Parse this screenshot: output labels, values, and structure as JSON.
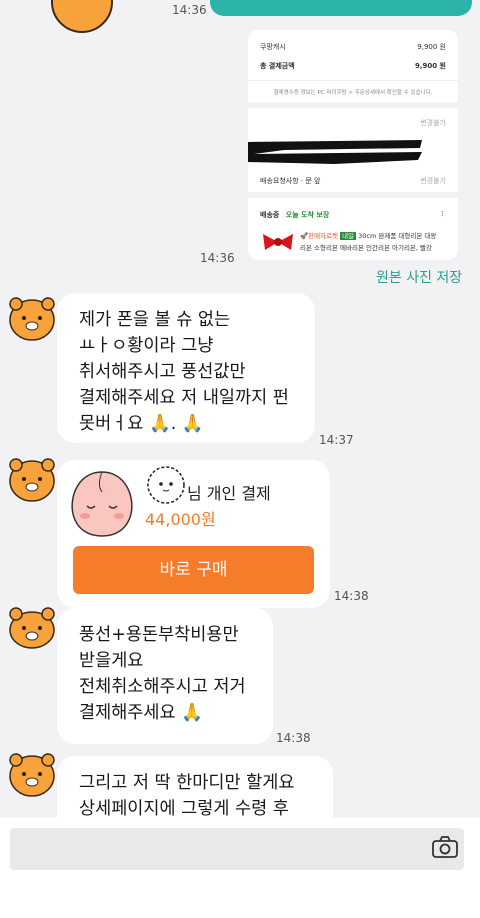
{
  "top": {
    "time": "14:36"
  },
  "receipt": {
    "coupang_cash_label": "쿠팡캐시",
    "coupang_cash_value": "9,900 원",
    "total_label": "총 결제금액",
    "total_value": "9,900 원",
    "notice": "결제영수증 정보는 PC 마이쿠팡 > 주문상세에서 확인할 수 있습니다.",
    "change_label_1": "변경불가",
    "delivery_request_label": "배송요청사항 · 문 앞",
    "change_label_2": "변경불가",
    "shipping_status": "배송중",
    "shipping_promise": "오늘 도착 보장",
    "product_badge_1": "🚀판매자로켓",
    "product_badge_2": "내일",
    "product_line_1": "30cm 완제품 대형리본 대왕",
    "product_line_2": "리본 소형리본 에바리본 인간리본 아기리본, 빨강"
  },
  "photo_time": "14:36",
  "save_original": "원본 사진 저장",
  "messages": [
    {
      "lines": [
        "제가 폰을 볼 슈 없는",
        "ㅛㅏㅇ황이라 그냥",
        "취서해주시고 풍선값만",
        "결제해주세요 저 내일까지 펀",
        "못버ㅓ요 🙏. 🙏"
      ],
      "time": "14:37"
    },
    {
      "lines": [
        "풍선+용돈부착비용만",
        "받을게요",
        "전체취소해주시고 저거",
        "결제해주세요 🙏"
      ],
      "time": "14:38"
    },
    {
      "lines": [
        "그리고 저 딱 한마디만 할게요",
        "상세페이지에 그렇게 수령 후"
      ]
    }
  ],
  "pay_card": {
    "title": "님 개인 결제",
    "price": "44,000원",
    "button": "바로 구매",
    "time": "14:38"
  },
  "colors": {
    "accent_orange": "#f57c2b",
    "teal": "#2ab3a6"
  }
}
